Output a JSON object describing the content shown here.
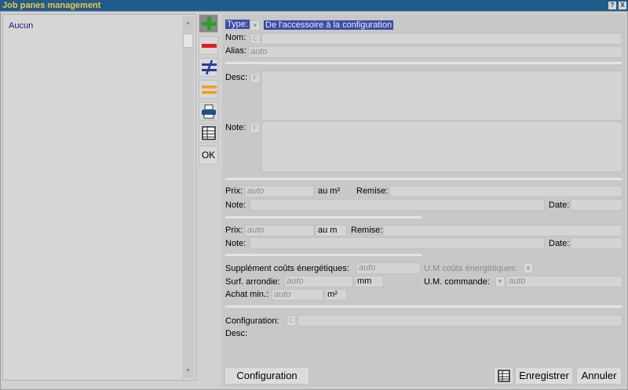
{
  "window": {
    "title": "Job panes management",
    "help_label": "?",
    "close_label": "X"
  },
  "list": {
    "items": [
      "Aucun"
    ]
  },
  "toolbar": {
    "ok_label": "OK"
  },
  "form": {
    "type": {
      "label": "Type:",
      "value": "De l'accessoire à la configuration"
    },
    "nom": {
      "label": "Nom:",
      "mini": "C",
      "value": ""
    },
    "alias": {
      "label": "Alias:",
      "placeholder": "auto"
    },
    "desc": {
      "label": "Desc:",
      "mini": "F"
    },
    "note": {
      "label": "Note:",
      "mini": "F"
    },
    "price1": {
      "prix_label": "Prix:",
      "prix_placeholder": "auto",
      "unit": "au m²",
      "remise_label": "Remise:",
      "note_label": "Note:",
      "date_label": "Date:"
    },
    "price2": {
      "prix_label": "Prix:",
      "prix_placeholder": "auto",
      "unit": "au m",
      "remise_label": "Remise:",
      "note_label": "Note:",
      "date_label": "Date:"
    },
    "extra": {
      "supplement_label": "Supplément coûts énergétiques:",
      "supplement_placeholder": "auto",
      "um_couts_label": "U.M coûts énergétiques:",
      "surf_label": "Surf. arrondie:",
      "surf_placeholder": "auto",
      "surf_unit": "mm",
      "um_commande_label": "U.M. commande:",
      "um_commande_placeholder": "auto",
      "achat_label": "Achat min.:",
      "achat_placeholder": "auto",
      "achat_unit": "m²"
    },
    "config": {
      "label": "Configuration:",
      "mini": "C",
      "desc_label": "Desc:"
    }
  },
  "buttons": {
    "configuration": "Configuration",
    "save": "Enregistrer",
    "cancel": "Annuler"
  },
  "colors": {
    "titlebar": "#1f5c8a",
    "title_text": "#f4c542",
    "add": "#2e9e2e",
    "remove": "#e02020",
    "compare": "#2a3a9a",
    "equal": "#f0a030",
    "selection": "#3d4fa3"
  },
  "icons": [
    "plus-icon",
    "minus-icon",
    "not-equal-icon",
    "equal-icon",
    "printer-icon",
    "grid-icon"
  ]
}
